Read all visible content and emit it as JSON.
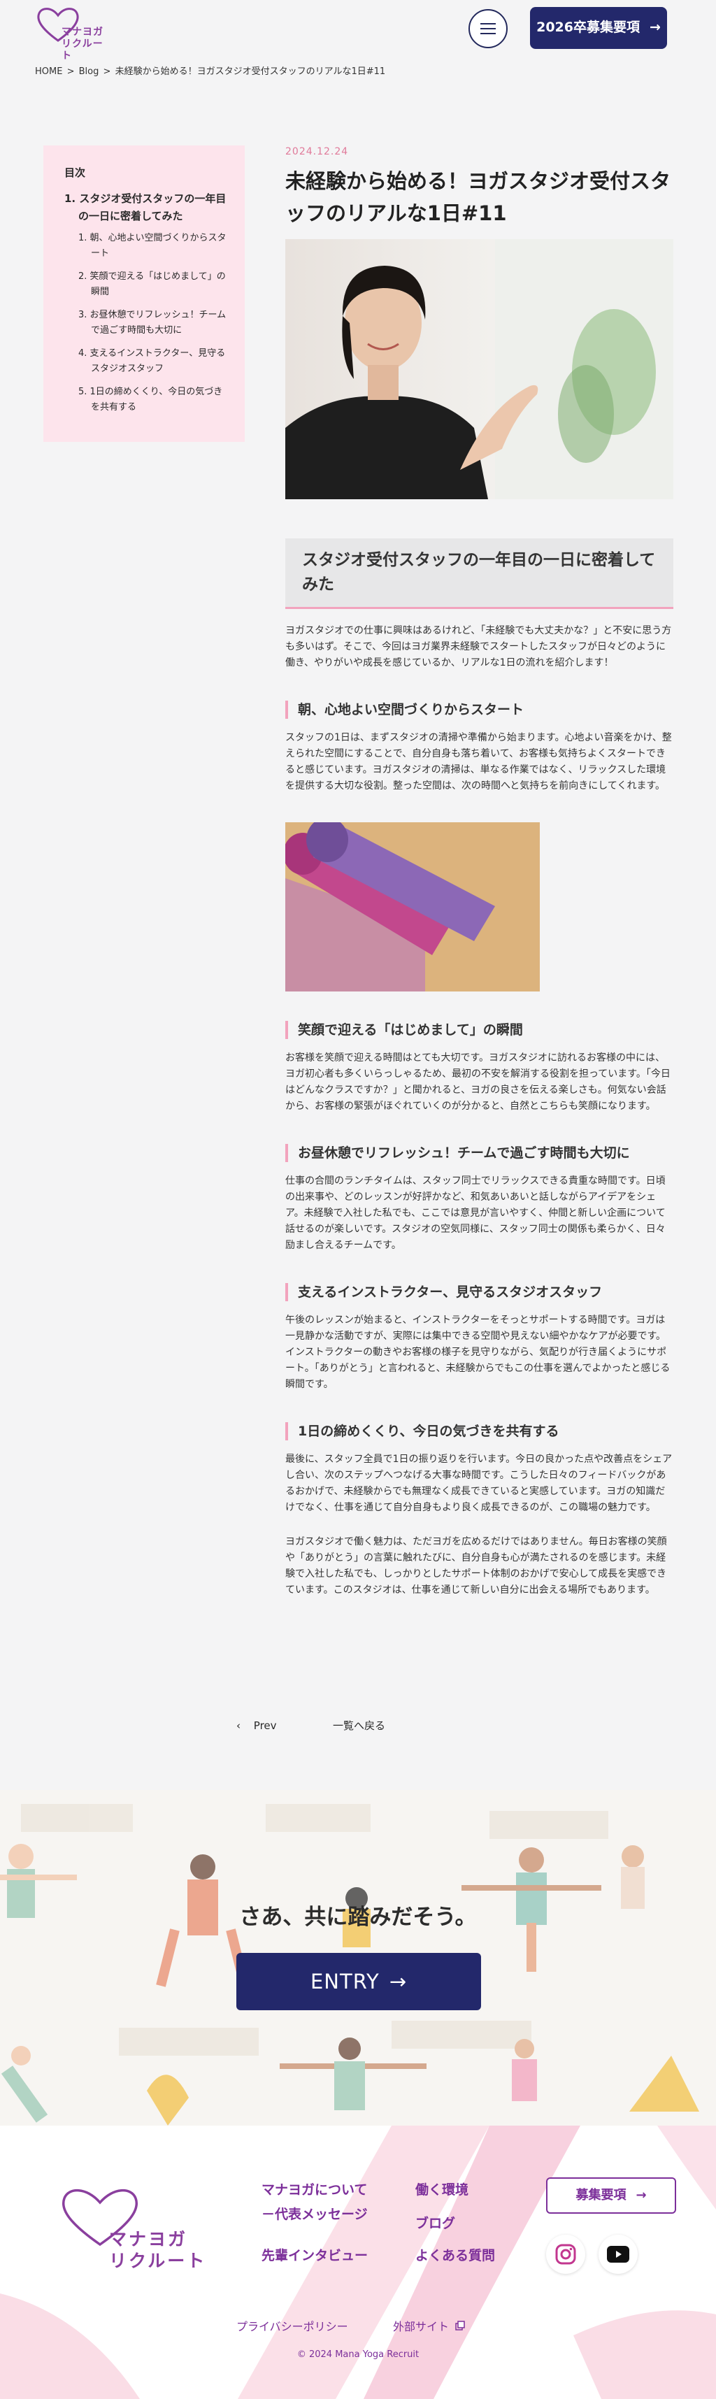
{
  "header": {
    "logo_text": "マナヨガ\nリクルート",
    "cta_label": "2026卒募集要項",
    "cta_arrow": "→"
  },
  "breadcrumb": {
    "home": "HOME",
    "sep": ">",
    "blog": "Blog",
    "current": "未経験から始める！ヨガスタジオ受付スタッフのリアルな1日#11"
  },
  "toc": {
    "title": "目次",
    "main": "1. スタジオ受付スタッフの一年目の一日に密着してみた",
    "items": [
      "1. 朝、心地よい空間づくりからスタート",
      "2. 笑顔で迎える「はじめまして」の瞬間",
      "3. お昼休憩でリフレッシュ！チームで過ごす時間も大切に",
      "4. 支えるインストラクター、見守るスタジオスタッフ",
      "5. 1日の締めくくり、今日の気づきを共有する"
    ]
  },
  "article": {
    "date": "2024.12.24",
    "title": "未経験から始める！ヨガスタジオ受付スタッフのリアルな1日#11",
    "h2": "スタジオ受付スタッフの一年目の一日に密着してみた",
    "intro": "ヨガスタジオでの仕事に興味はあるけれど、「未経験でも大丈夫かな？」と不安に思う方も多いはず。そこで、今回はヨガ業界未経験でスタートしたスタッフが日々どのように働き、やりがいや成長を感じているか、リアルな1日の流れを紹介します！",
    "sections": [
      {
        "heading": "朝、心地よい空間づくりからスタート",
        "body": "スタッフの1日は、まずスタジオの清掃や準備から始まります。心地よい音楽をかけ、整えられた空間にすることで、自分自身も落ち着いて、お客様も気持ちよくスタートできると感じています。ヨガスタジオの清掃は、単なる作業ではなく、リラックスした環境を提供する大切な役割。整った空間は、次の時間へと気持ちを前向きにしてくれます。"
      },
      {
        "heading": "笑顔で迎える「はじめまして」の瞬間",
        "body": "お客様を笑顔で迎える時間はとても大切です。ヨガスタジオに訪れるお客様の中には、ヨガ初心者も多くいらっしゃるため、最初の不安を解消する役割を担っています。「今日はどんなクラスですか？」と聞かれると、ヨガの良さを伝える楽しさも。何気ない会話から、お客様の緊張がほぐれていくのが分かると、自然とこちらも笑顔になります。"
      },
      {
        "heading": "お昼休憩でリフレッシュ！チームで過ごす時間も大切に",
        "body": "仕事の合間のランチタイムは、スタッフ同士でリラックスできる貴重な時間です。日頃の出来事や、どのレッスンが好評かなど、和気あいあいと話しながらアイデアをシェア。未経験で入社した私でも、ここでは意見が言いやすく、仲間と新しい企画について話せるのが楽しいです。スタジオの空気同様に、スタッフ同士の関係も柔らかく、日々励まし合えるチームです。"
      },
      {
        "heading": "支えるインストラクター、見守るスタジオスタッフ",
        "body": "午後のレッスンが始まると、インストラクターをそっとサポートする時間です。ヨガは一見静かな活動ですが、実際には集中できる空間や見えない細やかなケアが必要です。インストラクターの動きやお客様の様子を見守りながら、気配りが行き届くようにサポート。「ありがとう」と言われると、未経験からでもこの仕事を選んでよかったと感じる瞬間です。"
      },
      {
        "heading": "1日の締めくくり、今日の気づきを共有する",
        "body": "最後に、スタッフ全員で1日の振り返りを行います。今日の良かった点や改善点をシェアし合い、次のステップへつなげる大事な時間です。こうした日々のフィードバックがあるおかげで、未経験からでも無理なく成長できていると実感しています。ヨガの知識だけでなく、仕事を通じて自分自身もより良く成長できるのが、この職場の魅力です。"
      }
    ],
    "closing": "ヨガスタジオで働く魅力は、ただヨガを広めるだけではありません。毎日お客様の笑顔や「ありがとう」の言葉に触れたびに、自分自身も心が満たされるのを感じます。未経験で入社した私でも、しっかりとしたサポート体制のおかげで安心して成長を実感できています。このスタジオは、仕事を通じて新しい自分に出会える場所でもあります。"
  },
  "pager": {
    "prev_icon": "‹",
    "prev_label": "Prev",
    "list_label": "一覧へ戻る"
  },
  "entry": {
    "heading": "さあ、共に踏みだそう。",
    "button": "ENTRY",
    "arrow": "→"
  },
  "footer": {
    "logo_text": "マナヨガ\nリクルート",
    "links": {
      "about": "マナヨガについて",
      "message": "－代表メッセージ",
      "interview": "先輩インタビュー",
      "work": "働く環境",
      "blog": "ブログ",
      "faq": "よくある質問"
    },
    "recruit_label": "募集要項",
    "recruit_arrow": "→",
    "privacy": "プライバシーポリシー",
    "external": "外部サイト",
    "copyright": "© 2024 Mana Yoga Recruit"
  },
  "colors": {
    "navy": "#23286b",
    "purple": "#7c2f9a",
    "pink": "#f2a3bd",
    "toc_bg": "#fde4ec"
  }
}
